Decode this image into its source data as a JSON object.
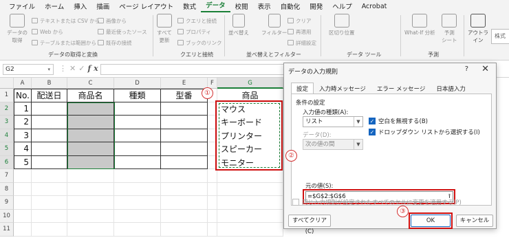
{
  "menu": [
    "ファイル",
    "ホーム",
    "挿入",
    "描画",
    "ページ レイアウト",
    "数式",
    "データ",
    "校閲",
    "表示",
    "自動化",
    "開発",
    "ヘルプ",
    "Acrobat"
  ],
  "menu_active_index": 6,
  "ribbon": {
    "get_data_label": "データの\n取得",
    "g1_items": [
      "テキストまたは CSV から",
      "Web から",
      "テーブルまたは範囲から"
    ],
    "g1_items2": [
      "画像から",
      "最近使ったソース",
      "既存の接続"
    ],
    "g1_label": "データの取得と変換",
    "refresh_label": "すべて\n更新",
    "g2_items": [
      "クエリと接続",
      "プロパティ",
      "ブックのリンク"
    ],
    "g2_label": "クエリと接続",
    "sort_label": "並べ替え",
    "filter_label": "フィルター",
    "g3_items": [
      "クリア",
      "再適用",
      "詳細設定"
    ],
    "g3_label": "並べ替えとフィルター",
    "split_label": "区切り位置",
    "g4_label": "データ ツール",
    "whatif_label": "What-If 分析",
    "forecast_label": "予測\nシート",
    "g5_label": "予測",
    "outline_label": "アウトラ\nイン",
    "stock_label": "株式"
  },
  "formula_bar": {
    "namebox": "G2",
    "fx": "fx"
  },
  "columns": [
    "A",
    "B",
    "C",
    "D",
    "E",
    "F",
    "G"
  ],
  "rows": [
    "1",
    "2",
    "3",
    "4",
    "5",
    "6",
    "7",
    "8",
    "9",
    "10",
    "11"
  ],
  "table": {
    "headers": [
      "No.",
      "配送日",
      "商品名",
      "種類",
      "型番"
    ],
    "numbers": [
      "1",
      "2",
      "3",
      "4",
      "5"
    ]
  },
  "list": {
    "header": "商品",
    "items": [
      "マウス",
      "キーボード",
      "プリンター",
      "スピーカー",
      "モニター"
    ]
  },
  "badges": {
    "b1": "①",
    "b2": "②",
    "b3": "③"
  },
  "dialog": {
    "title": "データの入力規則",
    "help": "?",
    "close": "✕",
    "tabs": [
      "設定",
      "入力時メッセージ",
      "エラー メッセージ",
      "日本語入力"
    ],
    "section": "条件の設定",
    "allow_label": "入力値の種類(A):",
    "allow_value": "リスト",
    "ignore_blank": "空白を無視する(B)",
    "dropdown": "ドロップダウン リストから選択する(I)",
    "data_label": "データ(D):",
    "data_value": "次の値の間",
    "source_label": "元の値(S):",
    "source_value": "=$G$2:$G$6",
    "apply_all": "同じ入力規則が設定されたすべてのセルに変更を適用する(P)",
    "clear_btn": "すべてクリア(C)",
    "ok_btn": "OK",
    "cancel_btn": "キャンセル"
  },
  "colors": {
    "green": "#1a7f37",
    "red": "#d01010",
    "select_gray": "#c9c9c9",
    "check_blue": "#1565c0"
  }
}
